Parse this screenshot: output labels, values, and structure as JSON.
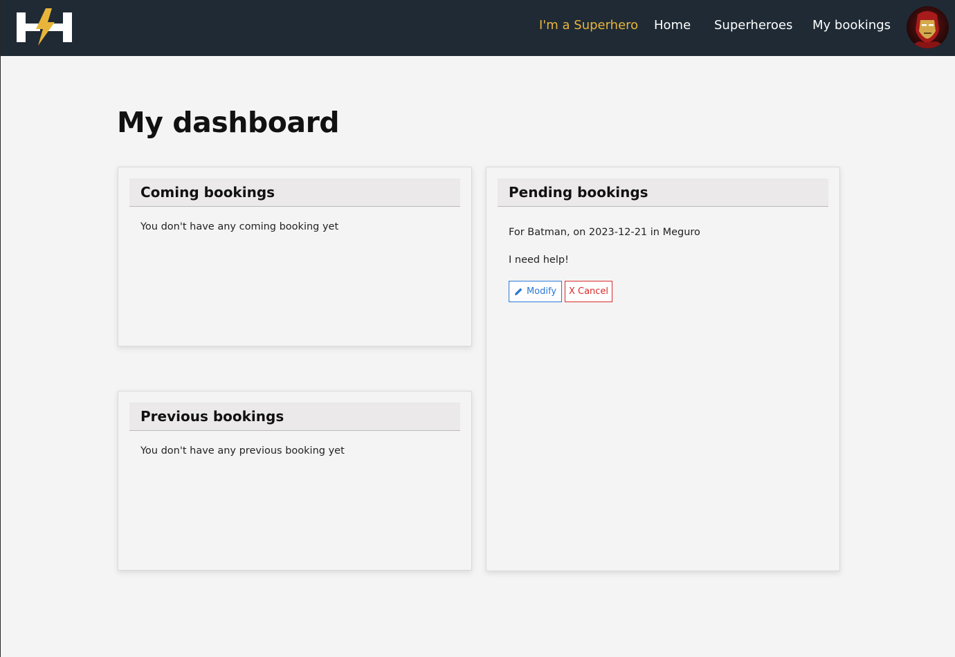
{
  "nav": {
    "logo_text": "HH",
    "links": [
      {
        "label": "I'm a Superhero"
      },
      {
        "label": "Home"
      },
      {
        "label": "Superheroes"
      },
      {
        "label": "My bookings"
      }
    ]
  },
  "main": {
    "title": "My dashboard",
    "coming": {
      "title": "Coming bookings",
      "empty_text": "You don't have any coming booking yet"
    },
    "previous": {
      "title": "Previous bookings",
      "empty_text": "You don't have any previous booking yet"
    },
    "pending": {
      "title": "Pending bookings",
      "booking": {
        "summary": "For Batman, on 2023-12-21 in Meguro",
        "message": "I need help!",
        "modify_label": "Modify",
        "cancel_label": "X Cancel"
      }
    }
  },
  "colors": {
    "navbar": "#1f2a35",
    "accent": "#e8b53a",
    "modify": "#2a78d6",
    "cancel": "#d92a2a"
  }
}
